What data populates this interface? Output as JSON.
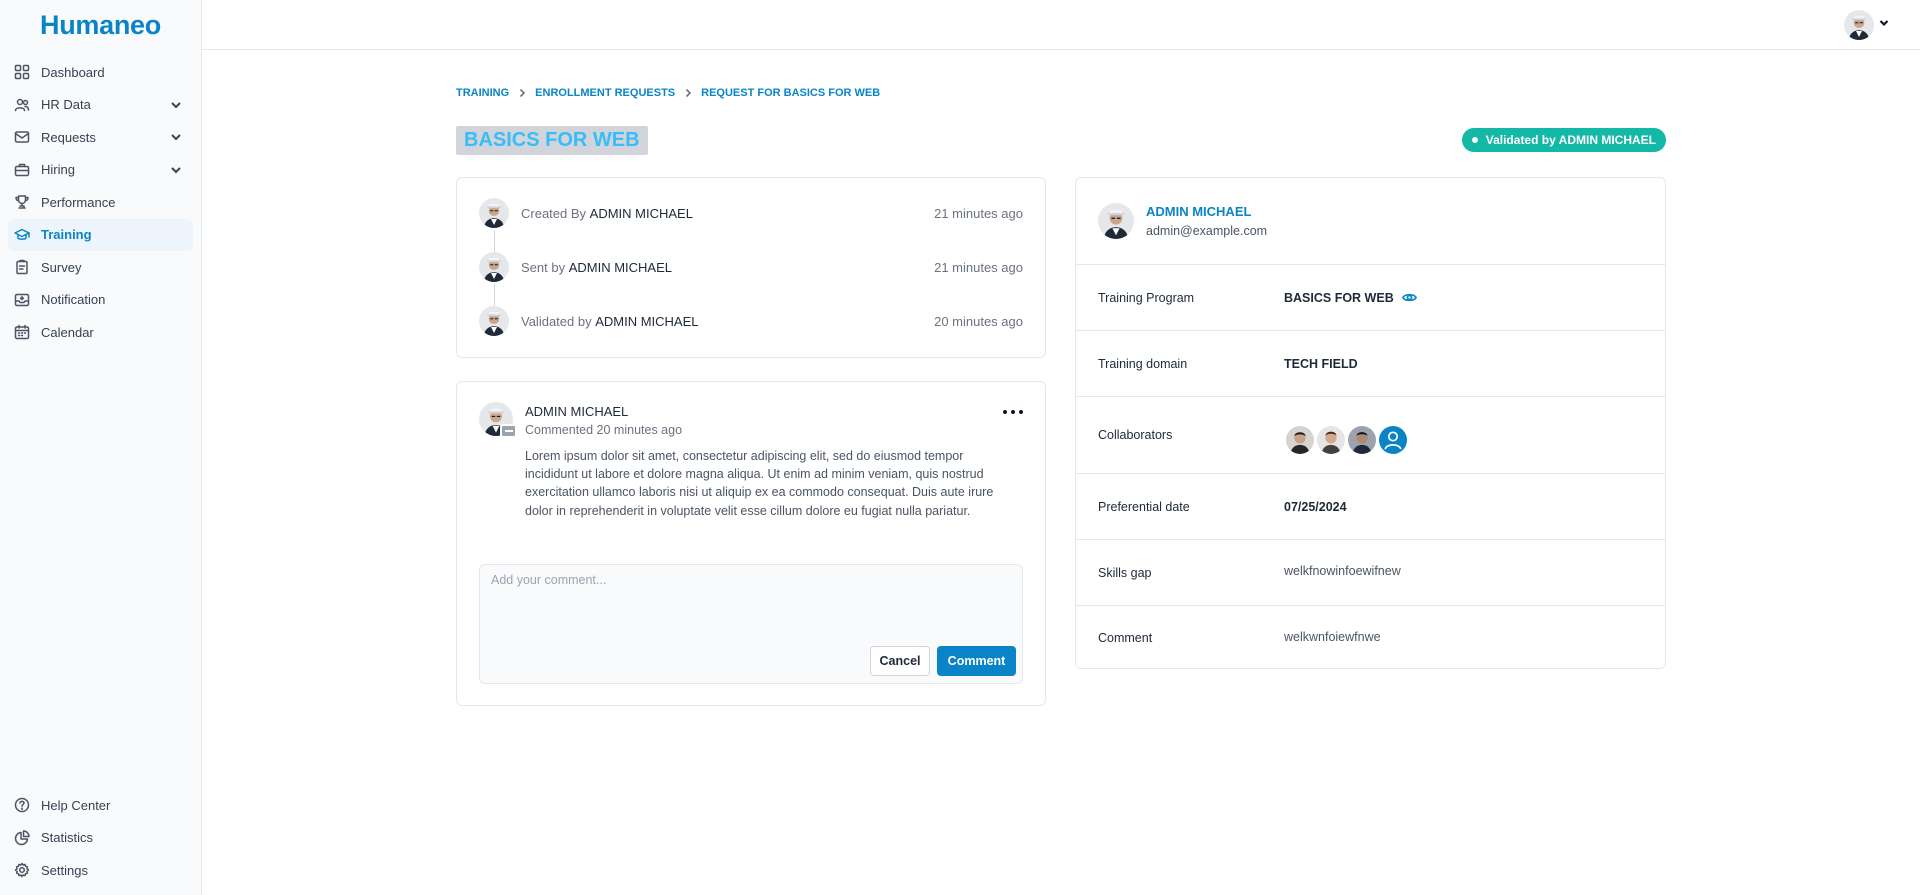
{
  "app": {
    "logo": "Humaneo"
  },
  "sidebar": {
    "items": [
      {
        "label": "Dashboard",
        "icon": "grid-icon"
      },
      {
        "label": "HR Data",
        "icon": "users-icon",
        "expandable": true
      },
      {
        "label": "Requests",
        "icon": "mail-icon",
        "expandable": true
      },
      {
        "label": "Hiring",
        "icon": "briefcase-icon",
        "expandable": true
      },
      {
        "label": "Performance",
        "icon": "trophy-icon"
      },
      {
        "label": "Training",
        "icon": "graduation-cap-icon",
        "active": true
      },
      {
        "label": "Survey",
        "icon": "clipboard-icon"
      },
      {
        "label": "Notification",
        "icon": "inbox-icon"
      },
      {
        "label": "Calendar",
        "icon": "calendar-icon"
      }
    ],
    "bottom_items": [
      {
        "label": "Help Center",
        "icon": "help-circle-icon"
      },
      {
        "label": "Statistics",
        "icon": "pie-chart-icon"
      },
      {
        "label": "Settings",
        "icon": "gear-icon"
      }
    ]
  },
  "breadcrumb": {
    "items": [
      "TRAINING",
      "ENROLLMENT REQUESTS",
      "REQUEST FOR BASICS FOR WEB"
    ]
  },
  "page": {
    "title": "BASICS FOR WEB",
    "status": "Validated by ADMIN MICHAEL"
  },
  "timeline": [
    {
      "prefix": "Created By",
      "name": "ADMIN MICHAEL",
      "time": "21 minutes ago"
    },
    {
      "prefix": "Sent by",
      "name": "ADMIN MICHAEL",
      "time": "21 minutes ago"
    },
    {
      "prefix": "Validated by",
      "name": "ADMIN MICHAEL",
      "time": "20 minutes ago"
    }
  ],
  "comment": {
    "author": "ADMIN MICHAEL",
    "meta": "Commented 20 minutes ago",
    "body": "Lorem ipsum dolor sit amet, consectetur adipiscing elit, sed do eiusmod tempor incididunt ut labore et dolore magna aliqua. Ut enim ad minim veniam, quis nostrud exercitation ullamco laboris nisi ut aliquip ex ea commodo consequat. Duis aute irure dolor in reprehenderit in voluptate velit esse cillum dolore eu fugiat nulla pariatur.",
    "input_placeholder": "Add your comment...",
    "input_value": "",
    "cancel_label": "Cancel",
    "submit_label": "Comment"
  },
  "requester": {
    "name": "ADMIN MICHAEL",
    "email": "admin@example.com"
  },
  "details": {
    "training_program_label": "Training Program",
    "training_program_value": "BASICS FOR WEB",
    "training_domain_label": "Training domain",
    "training_domain_value": "TECH FIELD",
    "collaborators_label": "Collaborators",
    "preferential_date_label": "Preferential date",
    "preferential_date_value": "07/25/2024",
    "skills_gap_label": "Skills gap",
    "skills_gap_value": "welkfnowinfoewifnew",
    "comment_label": "Comment",
    "comment_value": "welkwnfoiewfnwe"
  },
  "colors": {
    "brand": "#0a84c6",
    "status": "#14b8a6",
    "title_text": "#38bdf8"
  }
}
